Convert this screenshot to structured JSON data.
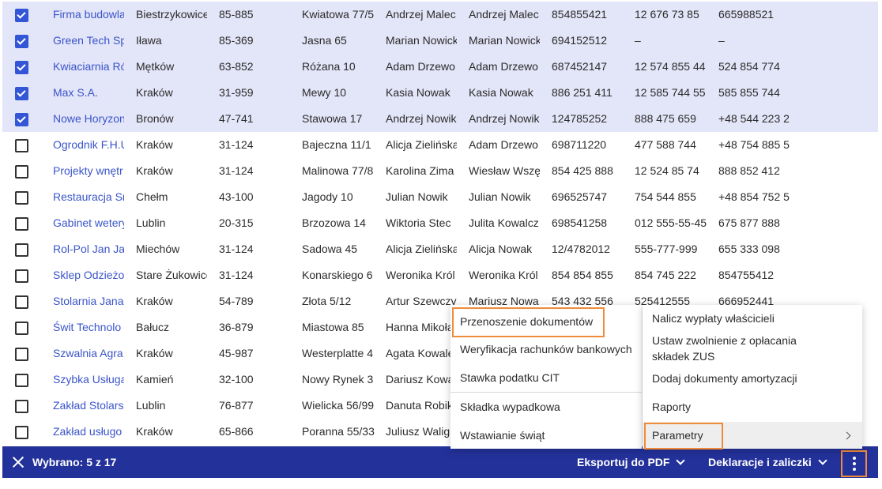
{
  "rows": [
    {
      "checked": true,
      "cells": [
        "Firma budowla",
        "Biestrzykowice",
        "85-885",
        "Kwiatowa 77/5",
        "Andrzej Malec",
        "Andrzej Malec",
        "854855421",
        "12 676 73 85",
        "665988521"
      ]
    },
    {
      "checked": true,
      "cells": [
        "Green Tech Sp",
        "Iława",
        "85-369",
        "Jasna 65",
        "Marian Nowicki",
        "Marian Nowicki",
        "694152512",
        "–",
        "–"
      ]
    },
    {
      "checked": true,
      "cells": [
        "Kwiaciarnia Ró",
        "Mętków",
        "63-852",
        "Różana 10",
        "Adam Drzewo",
        "Adam Drzewo",
        "687452147",
        "12 574 855 44",
        "524 854 774"
      ]
    },
    {
      "checked": true,
      "cells": [
        "Max S.A.",
        "Kraków",
        "31-959",
        "Mewy 10",
        "Kasia Nowak",
        "Kasia Nowak",
        "886 251 411",
        "12 585 744 55",
        "585 855 744"
      ]
    },
    {
      "checked": true,
      "cells": [
        "Nowe Horyzon",
        "Bronów",
        "47-741",
        "Stawowa 17",
        "Andrzej Nowik",
        "Andrzej Nowik",
        "124785252",
        "888 475 659",
        "+48 544 223 2"
      ]
    },
    {
      "checked": false,
      "cells": [
        "Ogrodnik F.H.U",
        "Kraków",
        "31-124",
        "Bajeczna 11/1",
        "Alicja Zielińska",
        "Adam Drzewo",
        "698711220",
        "477 588 744",
        "+48 754 885 5"
      ]
    },
    {
      "checked": false,
      "cells": [
        "Projekty wnętr",
        "Kraków",
        "31-124",
        "Malinowa 77/8",
        "Karolina Zima",
        "Wiesław Wszę",
        "854 425 888",
        "12 524 85 74",
        "888 852 412"
      ]
    },
    {
      "checked": false,
      "cells": [
        "Restauracja Sm",
        "Chełm",
        "43-100",
        "Jagody 10",
        "Julian Nowik",
        "Julian Nowik",
        "696525747",
        "754 544 855",
        "+48 854 752 5"
      ]
    },
    {
      "checked": false,
      "cells": [
        "Gabinet wetery",
        "Lublin",
        "20-315",
        "Brzozowa 14",
        "Wiktoria Stec",
        "Julita Kowalcz",
        "698541258",
        "012 555-55-45",
        "675 877 888"
      ]
    },
    {
      "checked": false,
      "cells": [
        "Rol-Pol Jan Ja",
        "Miechów",
        "31-124",
        "Sadowa 45",
        "Alicja Zielińska",
        "Alicja Nowak",
        "12/4782012",
        "555-777-999",
        "655 333 098"
      ]
    },
    {
      "checked": false,
      "cells": [
        "Sklep Odzieżo",
        "Stare Żukowice",
        "31-124",
        "Konarskiego 6",
        "Weronika Król",
        "Weronika Król",
        "854 854 855",
        "854 745 222",
        "854755412"
      ]
    },
    {
      "checked": false,
      "cells": [
        "Stolarnia Jana",
        "Kraków",
        "54-789",
        "Złota 5/12",
        "Artur Szewczy",
        "Mariusz Nowa",
        "543 432 556",
        "525412555",
        "666952441"
      ]
    },
    {
      "checked": false,
      "cells": [
        "Świt Technolo",
        "Bałucz",
        "36-879",
        "Miastowa 85",
        "Hanna Mikoła",
        "",
        "",
        "",
        ""
      ]
    },
    {
      "checked": false,
      "cells": [
        "Szwalnia Agra",
        "Kraków",
        "45-987",
        "Westerplatte 4",
        "Agata Kowale",
        "",
        "",
        "",
        ""
      ]
    },
    {
      "checked": false,
      "cells": [
        "Szybka Usługa",
        "Kamień",
        "32-100",
        "Nowy Rynek 3",
        "Dariusz Kowa",
        "",
        "",
        "",
        ""
      ]
    },
    {
      "checked": false,
      "cells": [
        "Zakład Stolars",
        "Lublin",
        "76-877",
        "Wielicka 56/99",
        "Danuta Robik",
        "",
        "",
        "",
        ""
      ]
    },
    {
      "checked": false,
      "cells": [
        "Zakład usługo",
        "Kraków",
        "65-866",
        "Poranna 55/33",
        "Juliusz Walig",
        "",
        "",
        "",
        ""
      ]
    }
  ],
  "actionbar": {
    "selected": "Wybrano: 5 z 17",
    "export_pdf": "Eksportuj do PDF",
    "declarations": "Deklaracje i zaliczki"
  },
  "submenu": {
    "items": [
      "Przenoszenie dokumentów",
      "Weryfikacja rachunków bankowych",
      "Stawka podatku CIT",
      "Składka wypadkowa",
      "Wstawianie świąt"
    ]
  },
  "mainmenu": {
    "items": [
      "Nalicz wypłaty właścicieli",
      "Ustaw zwolnienie z opłacania składek ZUS",
      "Dodaj dokumenty amortyzacji",
      "Raporty",
      "Parametry"
    ]
  },
  "colors": {
    "bar": "#23319a",
    "selected_row": "#e3e5f8",
    "link": "#3a55c9",
    "highlight": "#f08b3a",
    "checkbox": "#3356d6"
  }
}
